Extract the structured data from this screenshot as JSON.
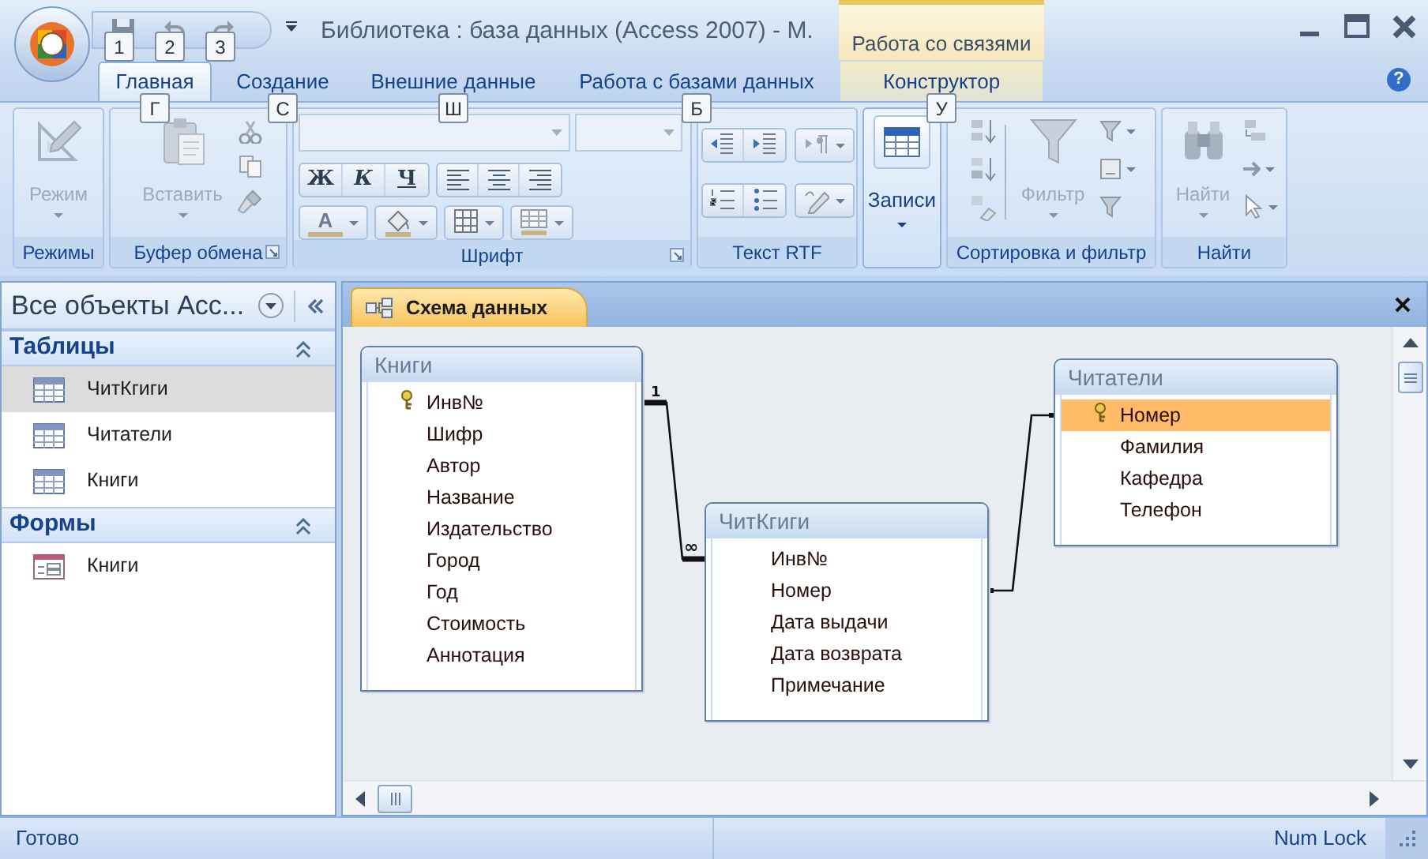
{
  "window": {
    "title": "Библиотека : база данных (Access 2007) - М.",
    "contextual_group": "Работа со связями"
  },
  "quick_access_keytips": [
    "1",
    "2",
    "3"
  ],
  "tabs": [
    {
      "label": "Главная",
      "selected": true,
      "keytip": "Г"
    },
    {
      "label": "Создание",
      "selected": false,
      "keytip": "С"
    },
    {
      "label": "Внешние данные",
      "selected": false,
      "keytip": "Ш"
    },
    {
      "label": "Работа с базами данных",
      "selected": false,
      "keytip": "Б"
    },
    {
      "label": "Конструктор",
      "selected": false,
      "keytip": "У",
      "contextual": true
    }
  ],
  "help_button": "?",
  "ribbon_groups": [
    {
      "kind": "views",
      "label": "Режимы",
      "button": {
        "label": "Режим",
        "disabled": true
      }
    },
    {
      "kind": "clipboard",
      "label": "Буфер обмена",
      "button": {
        "label": "Вставить",
        "disabled": true
      }
    },
    {
      "kind": "font",
      "label": "Шрифт",
      "style_buttons": [
        "Ж",
        "К",
        "Ч"
      ],
      "font_color_glyph": "A"
    },
    {
      "kind": "rtf",
      "label": "Текст RTF"
    },
    {
      "kind": "records",
      "button": {
        "label": "Записи",
        "disabled": false
      }
    },
    {
      "kind": "sort",
      "label": "Сортировка и фильтр",
      "button": {
        "label": "Фильтр",
        "disabled": true
      }
    },
    {
      "kind": "find",
      "label": "Найти",
      "button": {
        "label": "Найти",
        "disabled": true
      }
    }
  ],
  "navigation_pane": {
    "title": "Все объекты Acc...",
    "sections": [
      {
        "label": "Таблицы",
        "expanded": true,
        "items": [
          {
            "label": "ЧитКгиги",
            "kind": "table",
            "selected": true
          },
          {
            "label": "Читатели",
            "kind": "table",
            "selected": false
          },
          {
            "label": "Книги",
            "kind": "table",
            "selected": false
          }
        ]
      },
      {
        "label": "Формы",
        "expanded": true,
        "items": [
          {
            "label": "Книги",
            "kind": "form",
            "selected": false
          }
        ]
      }
    ]
  },
  "document_tabs": [
    {
      "label": "Схема данных",
      "selected": true
    }
  ],
  "diagram": {
    "tables": [
      {
        "title": "Книги",
        "fields": [
          {
            "name": "Инв№",
            "key": true,
            "selected": false
          },
          {
            "name": "Шифр",
            "key": false,
            "selected": false
          },
          {
            "name": "Автор",
            "key": false,
            "selected": false
          },
          {
            "name": "Название",
            "key": false,
            "selected": false
          },
          {
            "name": "Издательство",
            "key": false,
            "selected": false
          },
          {
            "name": "Город",
            "key": false,
            "selected": false
          },
          {
            "name": "Год",
            "key": false,
            "selected": false
          },
          {
            "name": "Стоимость",
            "key": false,
            "selected": false
          },
          {
            "name": "Аннотация",
            "key": false,
            "selected": false
          }
        ]
      },
      {
        "title": "ЧитКгиги",
        "fields": [
          {
            "name": "Инв№",
            "key": false,
            "selected": false
          },
          {
            "name": "Номер",
            "key": false,
            "selected": false
          },
          {
            "name": "Дата выдачи",
            "key": false,
            "selected": false
          },
          {
            "name": "Дата возврата",
            "key": false,
            "selected": false
          },
          {
            "name": "Примечание",
            "key": false,
            "selected": false
          }
        ]
      },
      {
        "title": "Читатели",
        "fields": [
          {
            "name": "Номер",
            "key": true,
            "selected": true
          },
          {
            "name": "Фамилия",
            "key": false,
            "selected": false
          },
          {
            "name": "Кафедра",
            "key": false,
            "selected": false
          },
          {
            "name": "Телефон",
            "key": false,
            "selected": false
          }
        ]
      }
    ],
    "relationships": [
      {
        "kind": "one-to-many",
        "from_label": "1",
        "to_label": "∞"
      },
      {
        "kind": "plain"
      }
    ]
  },
  "status_bar": {
    "left": "Готово",
    "right": "Num Lock"
  }
}
